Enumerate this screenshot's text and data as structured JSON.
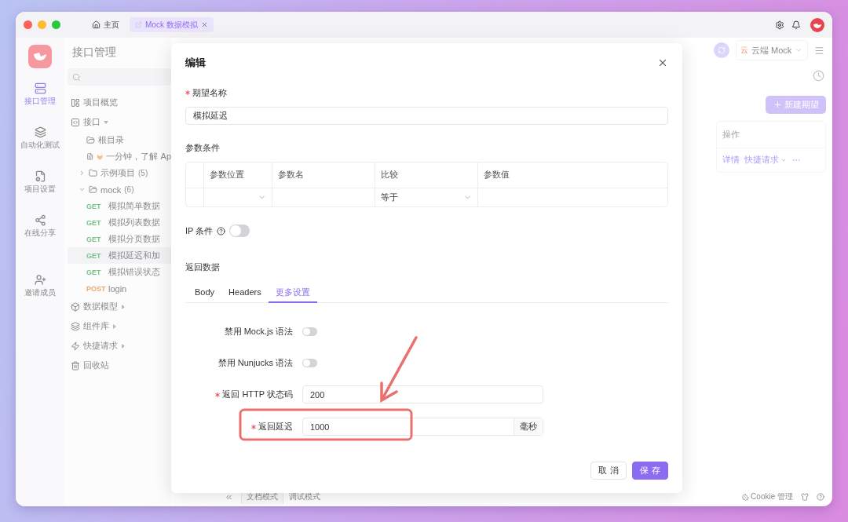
{
  "titlebar": {
    "tabs": [
      {
        "kind": "home",
        "label": "主页",
        "selected": false
      },
      {
        "kind": "page",
        "label": "Mock 数据模拟",
        "selected": true
      }
    ]
  },
  "rail": {
    "items": [
      {
        "kind": "api",
        "label": "接口管理",
        "selected": true
      },
      {
        "kind": "auto",
        "label": "自动化测试",
        "selected": false
      },
      {
        "kind": "settings",
        "label": "项目设置",
        "selected": false
      },
      {
        "kind": "share",
        "label": "在线分享",
        "selected": false
      },
      {
        "kind": "invite",
        "label": "邀请成员",
        "selected": false
      }
    ]
  },
  "tree": {
    "title": "接口管理",
    "items": [
      {
        "kind": "overview",
        "label": "项目概览"
      },
      {
        "kind": "apis",
        "label": "接口",
        "expanded": true,
        "children": [
          {
            "kind": "folder",
            "label": "根目录",
            "children": [
              {
                "kind": "doc",
                "label": "一分钟，了解 Ap"
              }
            ]
          },
          {
            "kind": "folder",
            "label": "示例项目",
            "count": "(5)",
            "expanded": false
          },
          {
            "kind": "folder",
            "label": "mock",
            "count": "(6)",
            "expanded": true,
            "children": [
              {
                "kind": "endpoint",
                "method": "GET",
                "label": "模拟简单数据",
                "selected": false
              },
              {
                "kind": "endpoint",
                "method": "GET",
                "label": "模拟列表数据",
                "selected": false
              },
              {
                "kind": "endpoint",
                "method": "GET",
                "label": "模拟分页数据",
                "selected": false
              },
              {
                "kind": "endpoint",
                "method": "GET",
                "label": "模拟延迟和加",
                "selected": true
              },
              {
                "kind": "endpoint",
                "method": "GET",
                "label": "模拟错误状态",
                "selected": false
              },
              {
                "kind": "endpoint",
                "method": "POST",
                "label": "login",
                "selected": false
              }
            ]
          }
        ]
      },
      {
        "kind": "models",
        "label": "数据模型",
        "expanded": false
      },
      {
        "kind": "components",
        "label": "组件库",
        "expanded": false
      },
      {
        "kind": "requests",
        "label": "快捷请求",
        "expanded": false
      },
      {
        "kind": "trash",
        "label": "回收站"
      }
    ]
  },
  "main": {
    "source": {
      "badge": "云",
      "label": "云端 Mock"
    },
    "new_button": "新建期望",
    "table": {
      "columns": [
        "操作"
      ],
      "rows": [
        {
          "actions": [
            "详情",
            "快捷请求"
          ]
        }
      ]
    }
  },
  "bottom_bar": {
    "modes": [
      {
        "label": "文档模式",
        "selected": true
      },
      {
        "label": "调试模式",
        "selected": false
      }
    ],
    "cookie": "Cookie 管理"
  },
  "modal": {
    "title": "编辑",
    "name_field": {
      "label": "期望名称",
      "required": true,
      "value": "模拟延迟"
    },
    "conditions": {
      "label": "参数条件",
      "columns": [
        "参数位置",
        "参数名",
        "比较",
        "参数值"
      ],
      "rows": [
        {
          "cells": [
            {
              "kind": "select"
            },
            {
              "kind": "input"
            },
            {
              "kind": "select",
              "value": "等于"
            },
            {
              "kind": "input"
            }
          ]
        }
      ]
    },
    "ip": {
      "label": "IP 条件",
      "on": false
    },
    "response": {
      "label": "返回数据",
      "tabs": [
        {
          "label": "Body",
          "selected": false
        },
        {
          "label": "Headers",
          "selected": false
        },
        {
          "label": "更多设置",
          "selected": true
        }
      ],
      "settings": [
        {
          "kind": "switch",
          "label": "禁用 Mock.js 语法",
          "on": false
        },
        {
          "kind": "switch",
          "label": "禁用 Nunjucks 语法",
          "on": false
        },
        {
          "kind": "input",
          "label": "返回 HTTP 状态码",
          "required": true,
          "value": "200"
        },
        {
          "kind": "input",
          "label": "返回延迟",
          "required": true,
          "value": "1000",
          "suffix": "毫秒"
        }
      ]
    },
    "buttons": [
      {
        "kind": "secondary",
        "label": "取 消"
      },
      {
        "kind": "primary",
        "label": "保 存"
      }
    ]
  }
}
